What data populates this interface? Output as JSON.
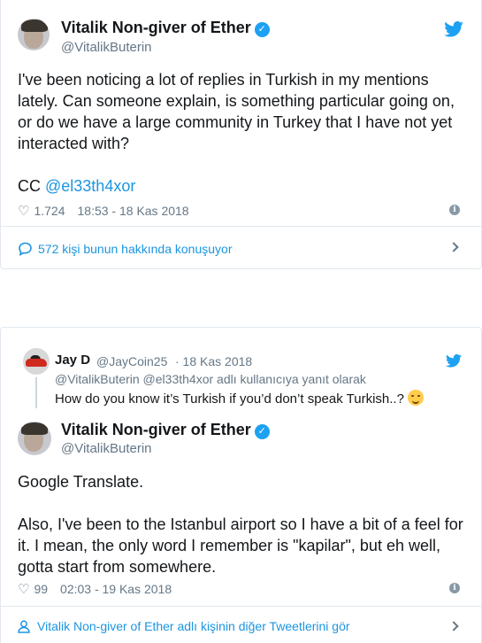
{
  "tweet": {
    "author_name": "Vitalik Non-giver of Ether",
    "author_handle": "@VitalikButerin",
    "text": "I've been noticing a lot of replies in Turkish in my mentions lately. Can someone explain, is something particular going on, or do we have a large community in Turkey that I have not yet interacted with?",
    "cc_prefix": "CC ",
    "cc_mention": "@el33th4xor",
    "likes": "1.724",
    "time": "18:53 - 18 Kas 2018",
    "conversation_link": "572 kişi bunun hakkında konuşuyor"
  },
  "reply_context": {
    "name": "Jay D",
    "handle": "@JayCoin25",
    "date": "· 18 Kas 2018",
    "replying_to": "@VitalikButerin @el33th4xor adlı kullanıcıya yanıt olarak",
    "text": "How do you know it’s Turkish if you’d don’t speak Turkish..?"
  },
  "reply_tweet": {
    "author_name": "Vitalik Non-giver of Ether",
    "author_handle": "@VitalikButerin",
    "text_line1": "Google Translate.",
    "text_body": "Also, I've been to the Istanbul airport so I have a bit of a feel for it. I mean, the only word I remember is \"kapilar\", but eh well, gotta start from somewhere.",
    "likes": "99",
    "time": "02:03 - 19 Kas 2018",
    "more_link": "Vitalik Non-giver of Ether adlı kişinin diğer Tweetlerini gör"
  },
  "colors": {
    "twitter_blue": "#1da1f2",
    "link_blue": "#1b95e0",
    "muted_gray": "#657786",
    "border": "#e1e8ed"
  },
  "icons": [
    "twitter-bird-icon",
    "verified-badge-icon",
    "heart-icon",
    "info-icon",
    "speech-bubble-icon",
    "chevron-right-icon",
    "person-icon",
    "grinning-face-emoji-icon"
  ]
}
